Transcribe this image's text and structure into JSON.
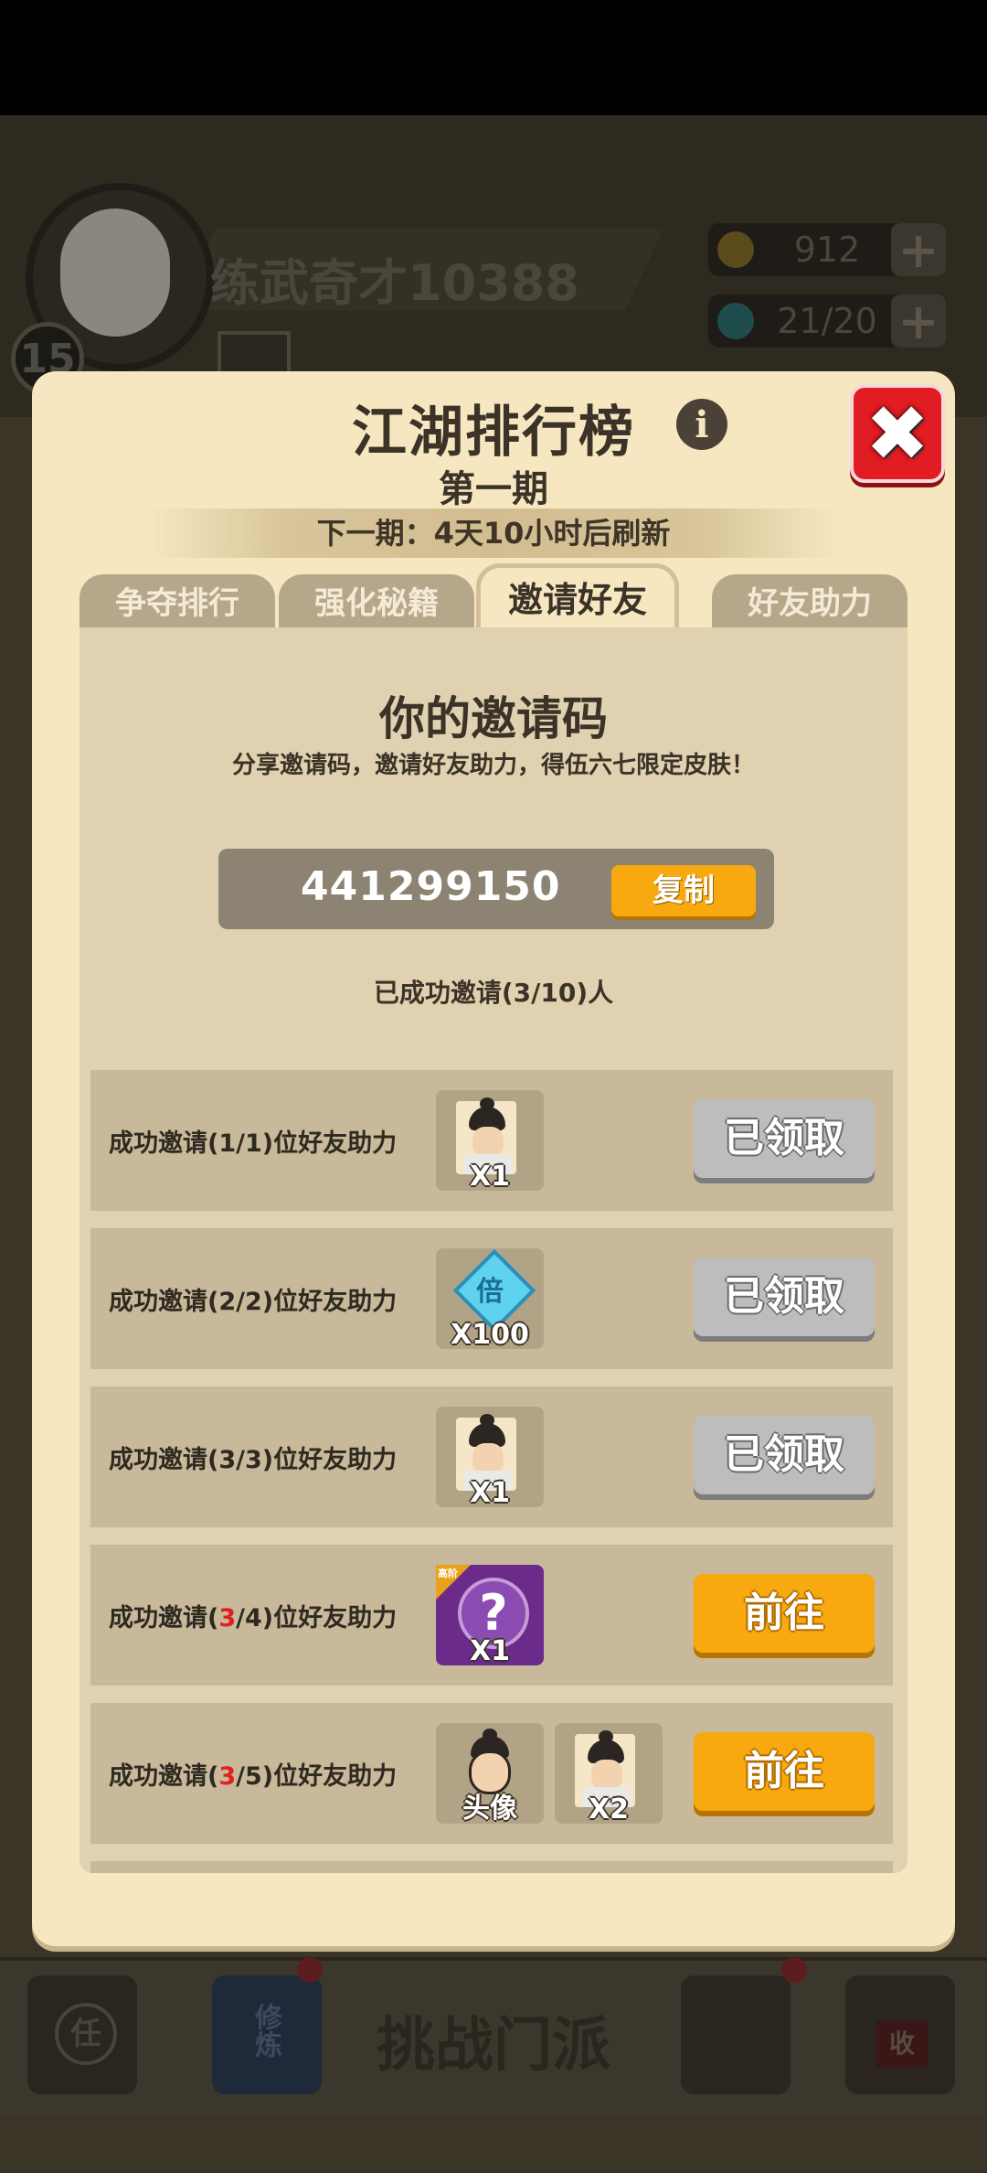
{
  "background": {
    "player_name": "练武奇才10388",
    "level": "15",
    "coins": "912",
    "energy": "21/20",
    "bottom_label": "挑战门派",
    "bottom_tab_1": "任",
    "bottom_tab_2": "修炼",
    "bottom_tab_5": "收"
  },
  "modal": {
    "title": "江湖排行榜",
    "subtitle": "第一期",
    "refresh_text": "下一期：4天10小时后刷新",
    "tabs": [
      "争夺排行",
      "强化秘籍",
      "邀请好友",
      "好友助力"
    ],
    "active_tab_index": 2
  },
  "invite": {
    "title": "你的邀请码",
    "description": "分享邀请码，邀请好友助力，得伍六七限定皮肤！",
    "code": "441299150",
    "copy_label": "复制",
    "invited_count": "已成功邀请(3/10)人"
  },
  "rows": [
    {
      "prefix": "成功邀请(",
      "current": "1",
      "suffix": "/1)位好友助力",
      "current_red": false,
      "rewards": [
        {
          "type": "hero",
          "count": "X1"
        }
      ],
      "button": "已领取",
      "state": "claimed"
    },
    {
      "prefix": "成功邀请(",
      "current": "2",
      "suffix": "/2)位好友助力",
      "current_red": false,
      "rewards": [
        {
          "type": "diamond",
          "icon_text": "倍",
          "count": "X100"
        }
      ],
      "button": "已领取",
      "state": "claimed"
    },
    {
      "prefix": "成功邀请(",
      "current": "3",
      "suffix": "/3)位好友助力",
      "current_red": false,
      "rewards": [
        {
          "type": "hero",
          "count": "X1"
        }
      ],
      "button": "已领取",
      "state": "claimed"
    },
    {
      "prefix": "成功邀请(",
      "current": "3",
      "suffix": "/4)位好友助力",
      "current_red": true,
      "rewards": [
        {
          "type": "mystery",
          "badge": "高阶",
          "count": "X1"
        }
      ],
      "button": "前往",
      "state": "go"
    },
    {
      "prefix": "成功邀请(",
      "current": "3",
      "suffix": "/5)位好友助力",
      "current_red": true,
      "rewards": [
        {
          "type": "avatar",
          "count": "头像"
        },
        {
          "type": "hero",
          "count": "X2"
        }
      ],
      "button": "前往",
      "state": "go"
    }
  ],
  "colors": {
    "modal_bg": "#f7e7c0",
    "panel_bg": "#e0d2b0",
    "row_bg": "#c7b999",
    "accent_orange": "#f7a90f",
    "claimed_gray": "#bdbdbd",
    "close_red": "#e21c23",
    "highlight_red": "#e02020"
  }
}
